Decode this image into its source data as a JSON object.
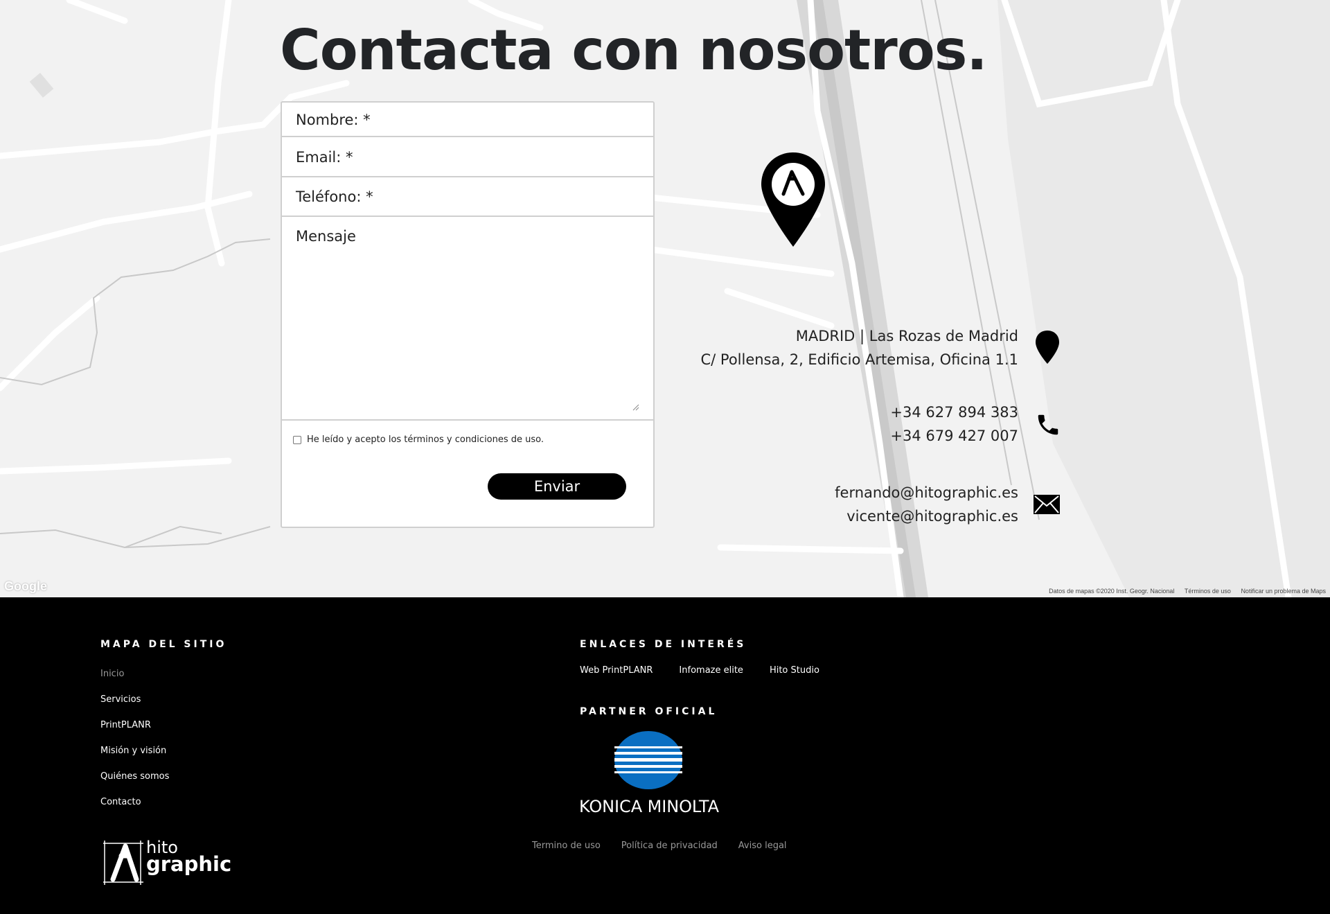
{
  "contact": {
    "title": "Contacta con nosotros.",
    "form": {
      "name_placeholder": "Nombre: *",
      "email_placeholder": "Email: *",
      "phone_placeholder": "Teléfono: *",
      "message_placeholder": "Mensaje",
      "terms_label": "He leído y acepto los términos y condiciones de uso.",
      "terms_checked": false,
      "submit_label": "Enviar"
    },
    "address": {
      "line1": "MADRID | Las Rozas de Madrid",
      "line2": "C/ Pollensa, 2, Edificio Artemisa, Oficina 1.1",
      "icon": "map-pin-icon"
    },
    "phones": {
      "items": [
        "+34 627 894 383",
        "+34 679 427 007"
      ],
      "icon": "phone-icon"
    },
    "emails": {
      "items": [
        "fernando@hitographic.es",
        "vicente@hitographic.es"
      ],
      "icon": "envelope-icon"
    }
  },
  "map": {
    "provider_label": "Google",
    "attribution": [
      "Datos de mapas ©2020 Inst. Geogr. Nacional",
      "Términos de uso",
      "Notificar un problema de Maps"
    ],
    "background_color": "#f2f2f2"
  },
  "footer": {
    "sitemap": {
      "heading": "MAPA DEL SITIO",
      "items": [
        "Inicio",
        "Servicios",
        "PrintPLANR",
        "Misión y visión",
        "Quiénes somos",
        "Contacto"
      ]
    },
    "links": {
      "heading": "ENLACES DE INTERÉS",
      "items": [
        "Web PrintPLANR",
        "Infomaze elite",
        "Hito Studio"
      ]
    },
    "partner": {
      "heading": "PARTNER OFICIAL",
      "logo_text": "KONICA MINOLTA",
      "logo_color": "#0a6fc2"
    },
    "legal": [
      "Termino de uso",
      "Política de privacidad",
      "Aviso legal"
    ],
    "brand": {
      "line1": "hito",
      "line2": "graphic"
    }
  }
}
